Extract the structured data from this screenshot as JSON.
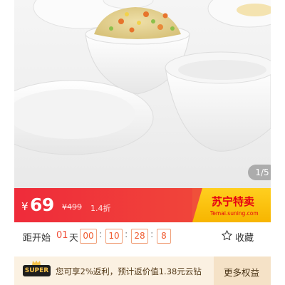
{
  "gallery": {
    "counter": "1/5"
  },
  "price": {
    "currency": "¥",
    "current": "69",
    "original": "¥499",
    "discount": "1.4折"
  },
  "brand": {
    "name": "苏宁特卖",
    "url": "Temai.suning.com"
  },
  "countdown": {
    "prefix": "距开始",
    "days": "01",
    "day_unit": "天",
    "hours": "00",
    "minutes": "10",
    "seconds": "28",
    "ms": "8",
    "colon": ":"
  },
  "favorite": {
    "label": "收藏"
  },
  "super": {
    "badge": "SUPER",
    "rebate_text": "您可享2%返利，预计返价值1.38元云钻",
    "more_label": "更多权益"
  },
  "colors": {
    "price_bar": "#ef2b3a",
    "brand_yellow": "#ffcf1f",
    "super_bg": "#fbf1e2",
    "countdown_accent": "#f05a2e"
  }
}
